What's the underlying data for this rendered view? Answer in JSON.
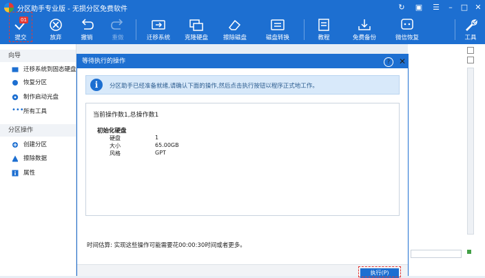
{
  "window": {
    "title": "分区助手专业版 - 无损分区免费软件",
    "controls": [
      "refresh-icon",
      "gift-icon",
      "menu-icon",
      "minimize-icon",
      "maximize-icon",
      "close-icon"
    ]
  },
  "toolbar": {
    "commit_label": "提交",
    "commit_badge": "01",
    "discard_label": "放弃",
    "undo_label": "撤销",
    "redo_label": "重做",
    "migrate_label": "迁移系统",
    "clone_label": "克隆硬盘",
    "wipe_label": "擦除磁盘",
    "convert_label": "磁盘转换",
    "tutorial_label": "教程",
    "backup_label": "免费备份",
    "wechat_label": "微信恢复",
    "tools_label": "工具"
  },
  "sidebar": {
    "section1": "向导",
    "wizard": [
      {
        "label": "迁移系统到固态硬盘",
        "icon": "migrate-icon"
      },
      {
        "label": "恢复分区",
        "icon": "recover-icon"
      },
      {
        "label": "制作启动光盘",
        "icon": "disc-icon"
      },
      {
        "label": "所有工具",
        "icon": "more-icon"
      }
    ],
    "section2": "分区操作",
    "ops": [
      {
        "label": "创建分区",
        "icon": "create-icon"
      },
      {
        "label": "擦除数据",
        "icon": "erase-icon"
      },
      {
        "label": "属性",
        "icon": "info-icon"
      }
    ]
  },
  "dialog": {
    "title": "等待执行的操作",
    "help": "?",
    "info": "分区助手已经准备就绪,请确认下面的操作,然后点击执行按钮以程序正式地工作。",
    "summary": "当前操作数1,总操作数1",
    "op_title": "初始化硬盘",
    "rows": [
      {
        "k": "硬盘",
        "v": "1"
      },
      {
        "k": "大小",
        "v": "65.00GB"
      },
      {
        "k": "风格",
        "v": "GPT"
      }
    ],
    "estimate": "时间估算: 实现这些操作可能需要花00:00:30时间或者更多。",
    "execute_label": "执行(P)"
  },
  "colors": {
    "accent": "#1d6fd1",
    "highlight": "#e53935"
  }
}
